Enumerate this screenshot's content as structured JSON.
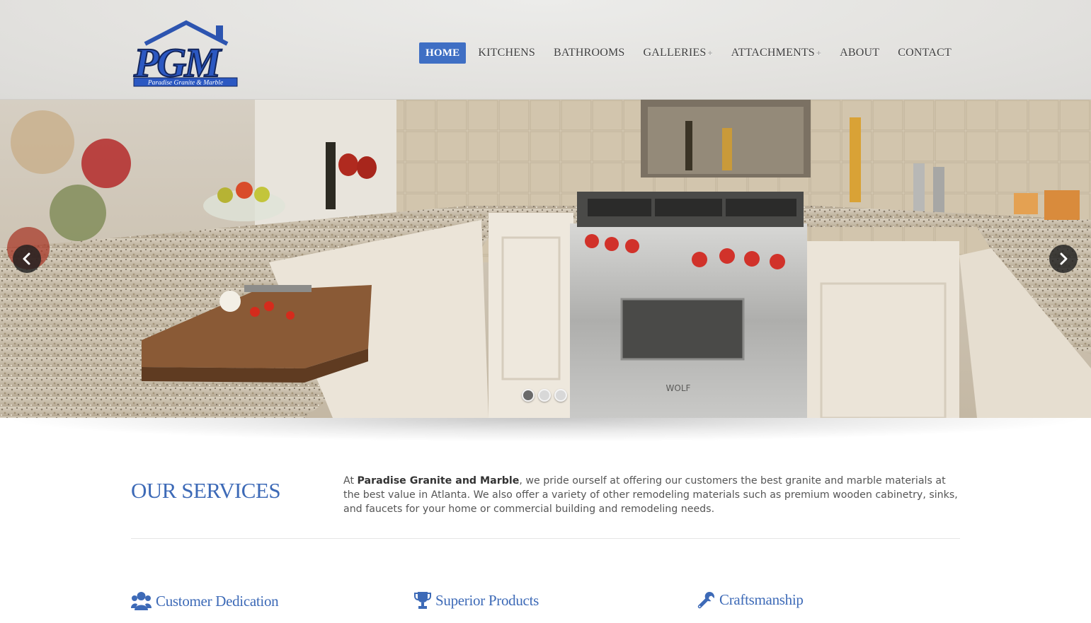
{
  "brand": {
    "logo_letters": "PGM",
    "logo_tagline": "Paradise Granite & Marble"
  },
  "nav": {
    "items": [
      {
        "label": "HOME",
        "active": true,
        "has_submenu": false
      },
      {
        "label": "KITCHENS",
        "active": false,
        "has_submenu": false
      },
      {
        "label": "BATHROOMS",
        "active": false,
        "has_submenu": false
      },
      {
        "label": "GALLERIES",
        "active": false,
        "has_submenu": true
      },
      {
        "label": "ATTACHMENTS",
        "active": false,
        "has_submenu": true
      },
      {
        "label": "ABOUT",
        "active": false,
        "has_submenu": false
      },
      {
        "label": "CONTACT",
        "active": false,
        "has_submenu": false
      }
    ],
    "submenu_marker": "+"
  },
  "slider": {
    "slide_count": 3,
    "active_slide": 1,
    "prev_icon": "chevron-left-icon",
    "next_icon": "chevron-right-icon",
    "range_brand": "WOLF"
  },
  "services": {
    "title": "OUR SERVICES",
    "intro_prefix": "At ",
    "company_name": "Paradise Granite and Marble",
    "intro_rest": ", we pride ourself at offering our customers the best granite and marble materials at the best value in Atlanta. We also offer a variety of other remodeling materials such as premium wooden cabinetry, sinks, and faucets for your home or commercial building and remodeling needs."
  },
  "features": [
    {
      "label": "Customer Dedication",
      "icon": "users-icon"
    },
    {
      "label": "Superior Products",
      "icon": "trophy-icon"
    },
    {
      "label": "Craftsmanship",
      "icon": "wrench-icon"
    }
  ],
  "colors": {
    "accent": "#3d6ab7",
    "nav_active_bg": "#3f6fc4",
    "body_text": "#555555"
  }
}
